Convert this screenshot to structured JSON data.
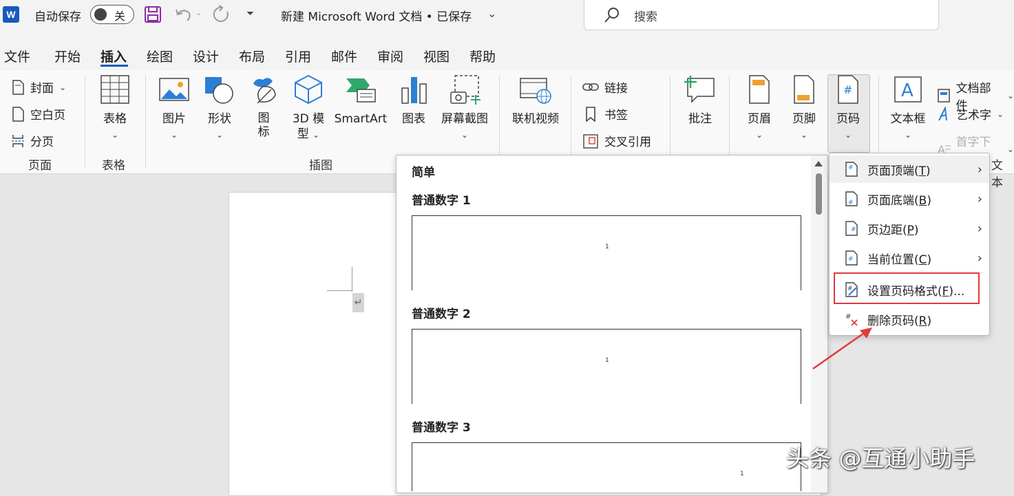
{
  "titlebar": {
    "autosave_label": "自动保存",
    "toggle_state": "关",
    "doc_title": "新建 Microsoft Word 文档 • 已保存",
    "search_placeholder": "搜索"
  },
  "tabs": [
    "文件",
    "开始",
    "插入",
    "绘图",
    "设计",
    "布局",
    "引用",
    "邮件",
    "审阅",
    "视图",
    "帮助"
  ],
  "active_tab": "插入",
  "ribbon": {
    "page_group": {
      "label": "页面",
      "items": [
        "封面",
        "空白页",
        "分页"
      ]
    },
    "table_group": {
      "label": "表格",
      "button": "表格"
    },
    "illustrations_group": {
      "label": "插图",
      "buttons": {
        "picture": "图片",
        "shape": "形状",
        "icon_1": "图",
        "icon_2": "标",
        "model_1": "3D 模",
        "model_2": "型",
        "smartart": "SmartArt",
        "chart": "图表",
        "screenshot": "屏幕截图"
      }
    },
    "media": {
      "online_video": "联机视频"
    },
    "links": {
      "link": "链接",
      "bookmark": "书签",
      "crossref": "交叉引用"
    },
    "comment": {
      "label": "批注"
    },
    "header_footer": {
      "header": "页眉",
      "footer": "页脚",
      "page_number": "页码"
    },
    "text_group": {
      "textbox": "文本框",
      "doc_parts": "文档部件",
      "wordart": "艺术字",
      "dropcap": "首字下沉",
      "group_label": "文本"
    }
  },
  "gallery": {
    "section": "简单",
    "items": [
      {
        "title": "普通数字 1",
        "number": "1"
      },
      {
        "title": "普通数字 2",
        "number": "1"
      },
      {
        "title": "普通数字 3",
        "number": "1"
      }
    ]
  },
  "page_number_menu": [
    {
      "label": "页面顶端(",
      "key": "T",
      "tail": ")",
      "submenu": true
    },
    {
      "label": "页面底端(",
      "key": "B",
      "tail": ")",
      "submenu": true
    },
    {
      "label": "页边距(",
      "key": "P",
      "tail": ")",
      "submenu": true
    },
    {
      "label": "当前位置(",
      "key": "C",
      "tail": ")",
      "submenu": true
    },
    {
      "label": "设置页码格式(",
      "key": "F",
      "tail": ")...",
      "submenu": false,
      "highlighted": true
    },
    {
      "label": "删除页码(",
      "key": "R",
      "tail": ")",
      "submenu": false
    }
  ],
  "watermark": "头条 @互通小助手",
  "colors": {
    "accent": "#185abd",
    "highlight": "#e03b3b",
    "icon_orange": "#f0a030",
    "icon_blue": "#2b7fd4"
  }
}
